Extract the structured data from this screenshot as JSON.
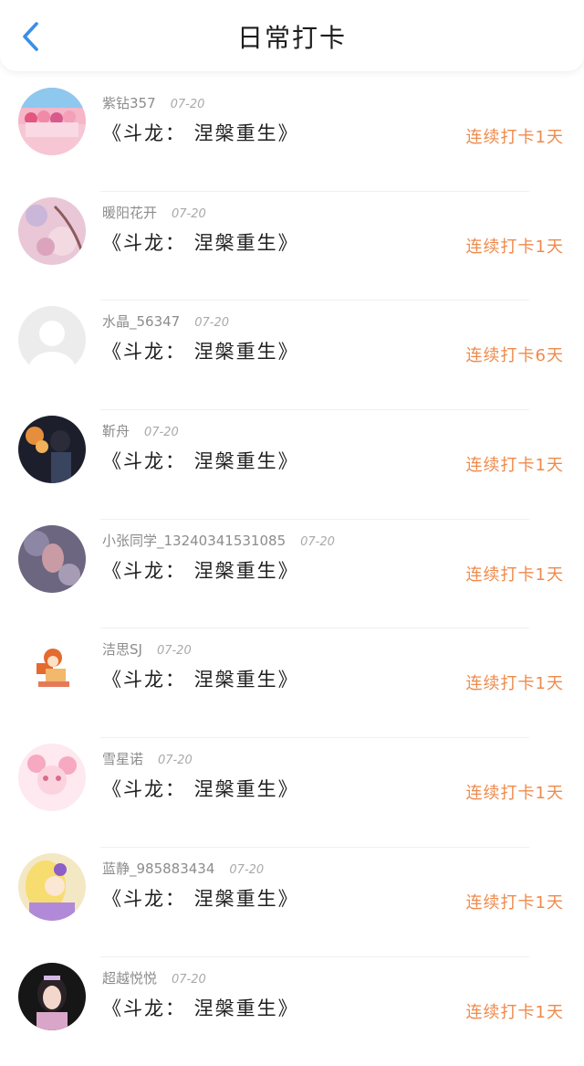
{
  "header": {
    "title": "日常打卡"
  },
  "checkins": [
    {
      "user": "紫钻357",
      "date": "07-20",
      "book": "《斗龙： 涅槃重生》",
      "streak": "连续打卡1天"
    },
    {
      "user": "暖阳花开",
      "date": "07-20",
      "book": "《斗龙： 涅槃重生》",
      "streak": "连续打卡1天"
    },
    {
      "user": "水晶_56347",
      "date": "07-20",
      "book": "《斗龙： 涅槃重生》",
      "streak": "连续打卡6天"
    },
    {
      "user": "靳舟",
      "date": "07-20",
      "book": "《斗龙： 涅槃重生》",
      "streak": "连续打卡1天"
    },
    {
      "user": "小张同学_13240341531085",
      "date": "07-20",
      "book": "《斗龙： 涅槃重生》",
      "streak": "连续打卡1天"
    },
    {
      "user": "洁思SJ",
      "date": "07-20",
      "book": "《斗龙： 涅槃重生》",
      "streak": "连续打卡1天"
    },
    {
      "user": "雪星诺",
      "date": "07-20",
      "book": "《斗龙： 涅槃重生》",
      "streak": "连续打卡1天"
    },
    {
      "user": "蓝静_985883434",
      "date": "07-20",
      "book": "《斗龙： 涅槃重生》",
      "streak": "连续打卡1天"
    },
    {
      "user": "超越悦悦",
      "date": "07-20",
      "book": "《斗龙： 涅槃重生》",
      "streak": "连续打卡1天"
    }
  ],
  "colors": {
    "accent_back": "#3a8ee8",
    "streak_text": "#ef8a4c"
  },
  "icons": {
    "back": "chevron-left-icon"
  }
}
